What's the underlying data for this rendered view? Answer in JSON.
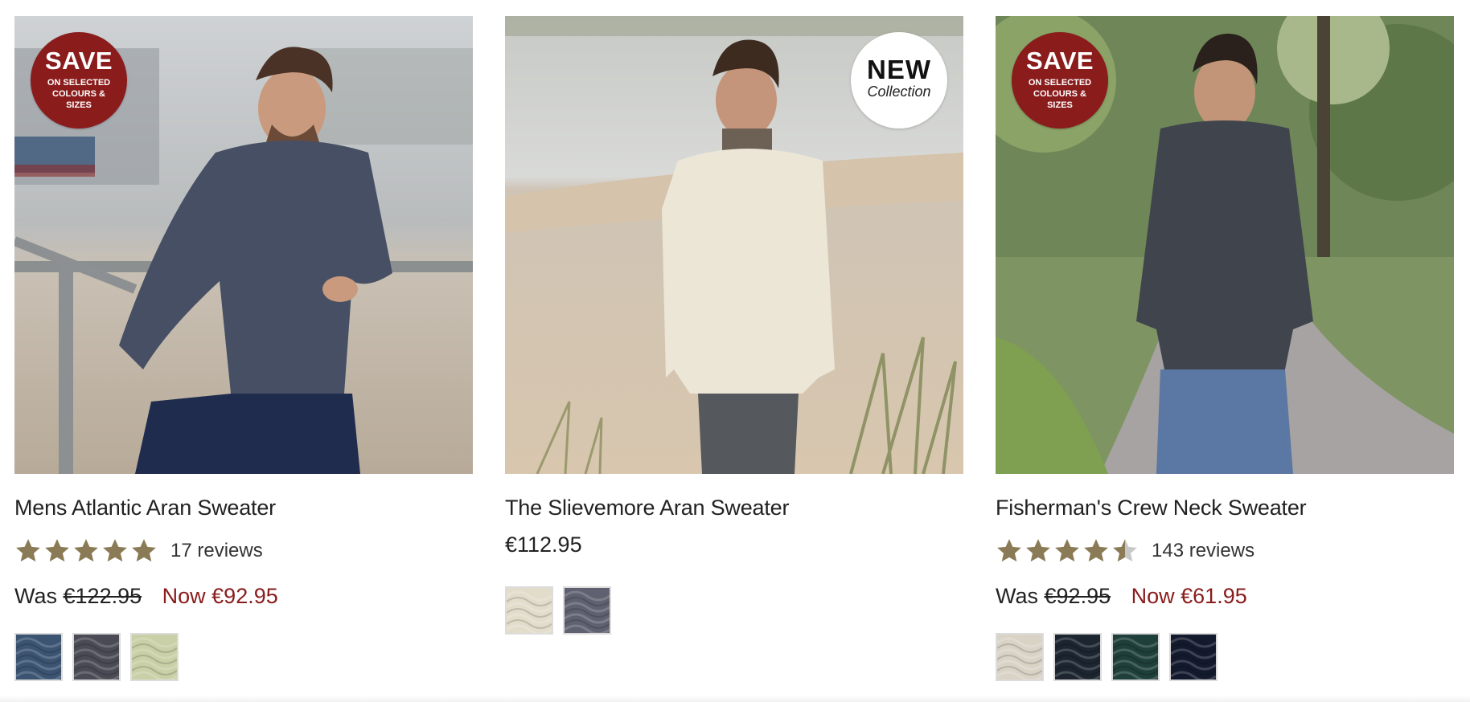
{
  "products": [
    {
      "title": "Mens Atlantic Aran Sweater",
      "badge": {
        "type": "save",
        "line1": "SAVE",
        "line2": "ON SELECTED COLOURS & SIZES"
      },
      "rating": 5,
      "reviews": "17 reviews",
      "was_label": "Was",
      "was_price": "€122.95",
      "now_price": "Now €92.95",
      "swatches": [
        {
          "name": "blue-marl",
          "color": "#3b5472"
        },
        {
          "name": "charcoal",
          "color": "#4a4b55"
        },
        {
          "name": "green-cream",
          "color": "#c9cfa6"
        }
      ]
    },
    {
      "title": "The Slievemore Aran Sweater",
      "badge": {
        "type": "new",
        "line1": "NEW",
        "line2": "Collection"
      },
      "price": "€112.95",
      "swatches": [
        {
          "name": "natural",
          "color": "#e2dccb"
        },
        {
          "name": "grey",
          "color": "#5f6170"
        }
      ]
    },
    {
      "title": "Fisherman's Crew Neck Sweater",
      "badge": {
        "type": "save",
        "line1": "SAVE",
        "line2": "ON SELECTED COLOURS & SIZES"
      },
      "rating": 4.5,
      "reviews": "143 reviews",
      "was_label": "Was",
      "was_price": "€92.95",
      "now_price": "Now €61.95",
      "swatches": [
        {
          "name": "natural",
          "color": "#d9d3c6"
        },
        {
          "name": "navy-black",
          "color": "#1c2530"
        },
        {
          "name": "dark-green",
          "color": "#1f3f3a"
        },
        {
          "name": "navy",
          "color": "#141a2e"
        }
      ]
    }
  ],
  "colors": {
    "accent_red": "#8a1c1c",
    "star_gold": "#8a7a55",
    "star_empty": "#c8c8c8"
  }
}
